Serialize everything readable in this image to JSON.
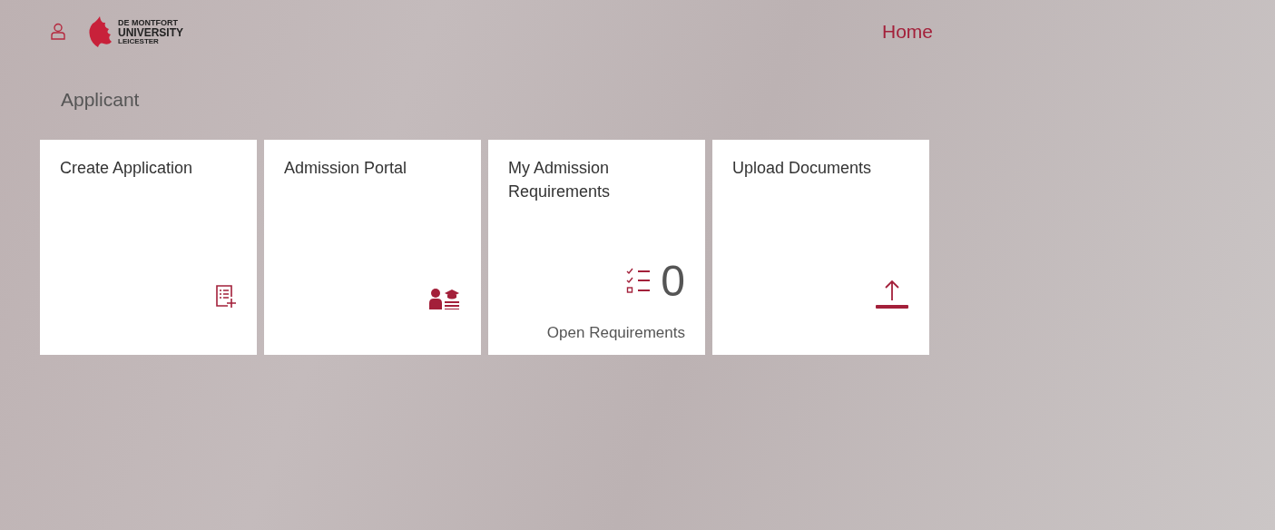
{
  "header": {
    "logo_lines": [
      "DE MONTFORT",
      "UNIVERSITY",
      "LEICESTER"
    ],
    "nav_link": "Home"
  },
  "section_title": "Applicant",
  "tiles": [
    {
      "title": "Create Application",
      "kind": "form"
    },
    {
      "title": "Admission Portal",
      "kind": "student"
    },
    {
      "title": "My Admission Requirements",
      "kind": "checklist",
      "count": "0",
      "footer": "Open Requirements"
    },
    {
      "title": "Upload Documents",
      "kind": "upload"
    }
  ]
}
